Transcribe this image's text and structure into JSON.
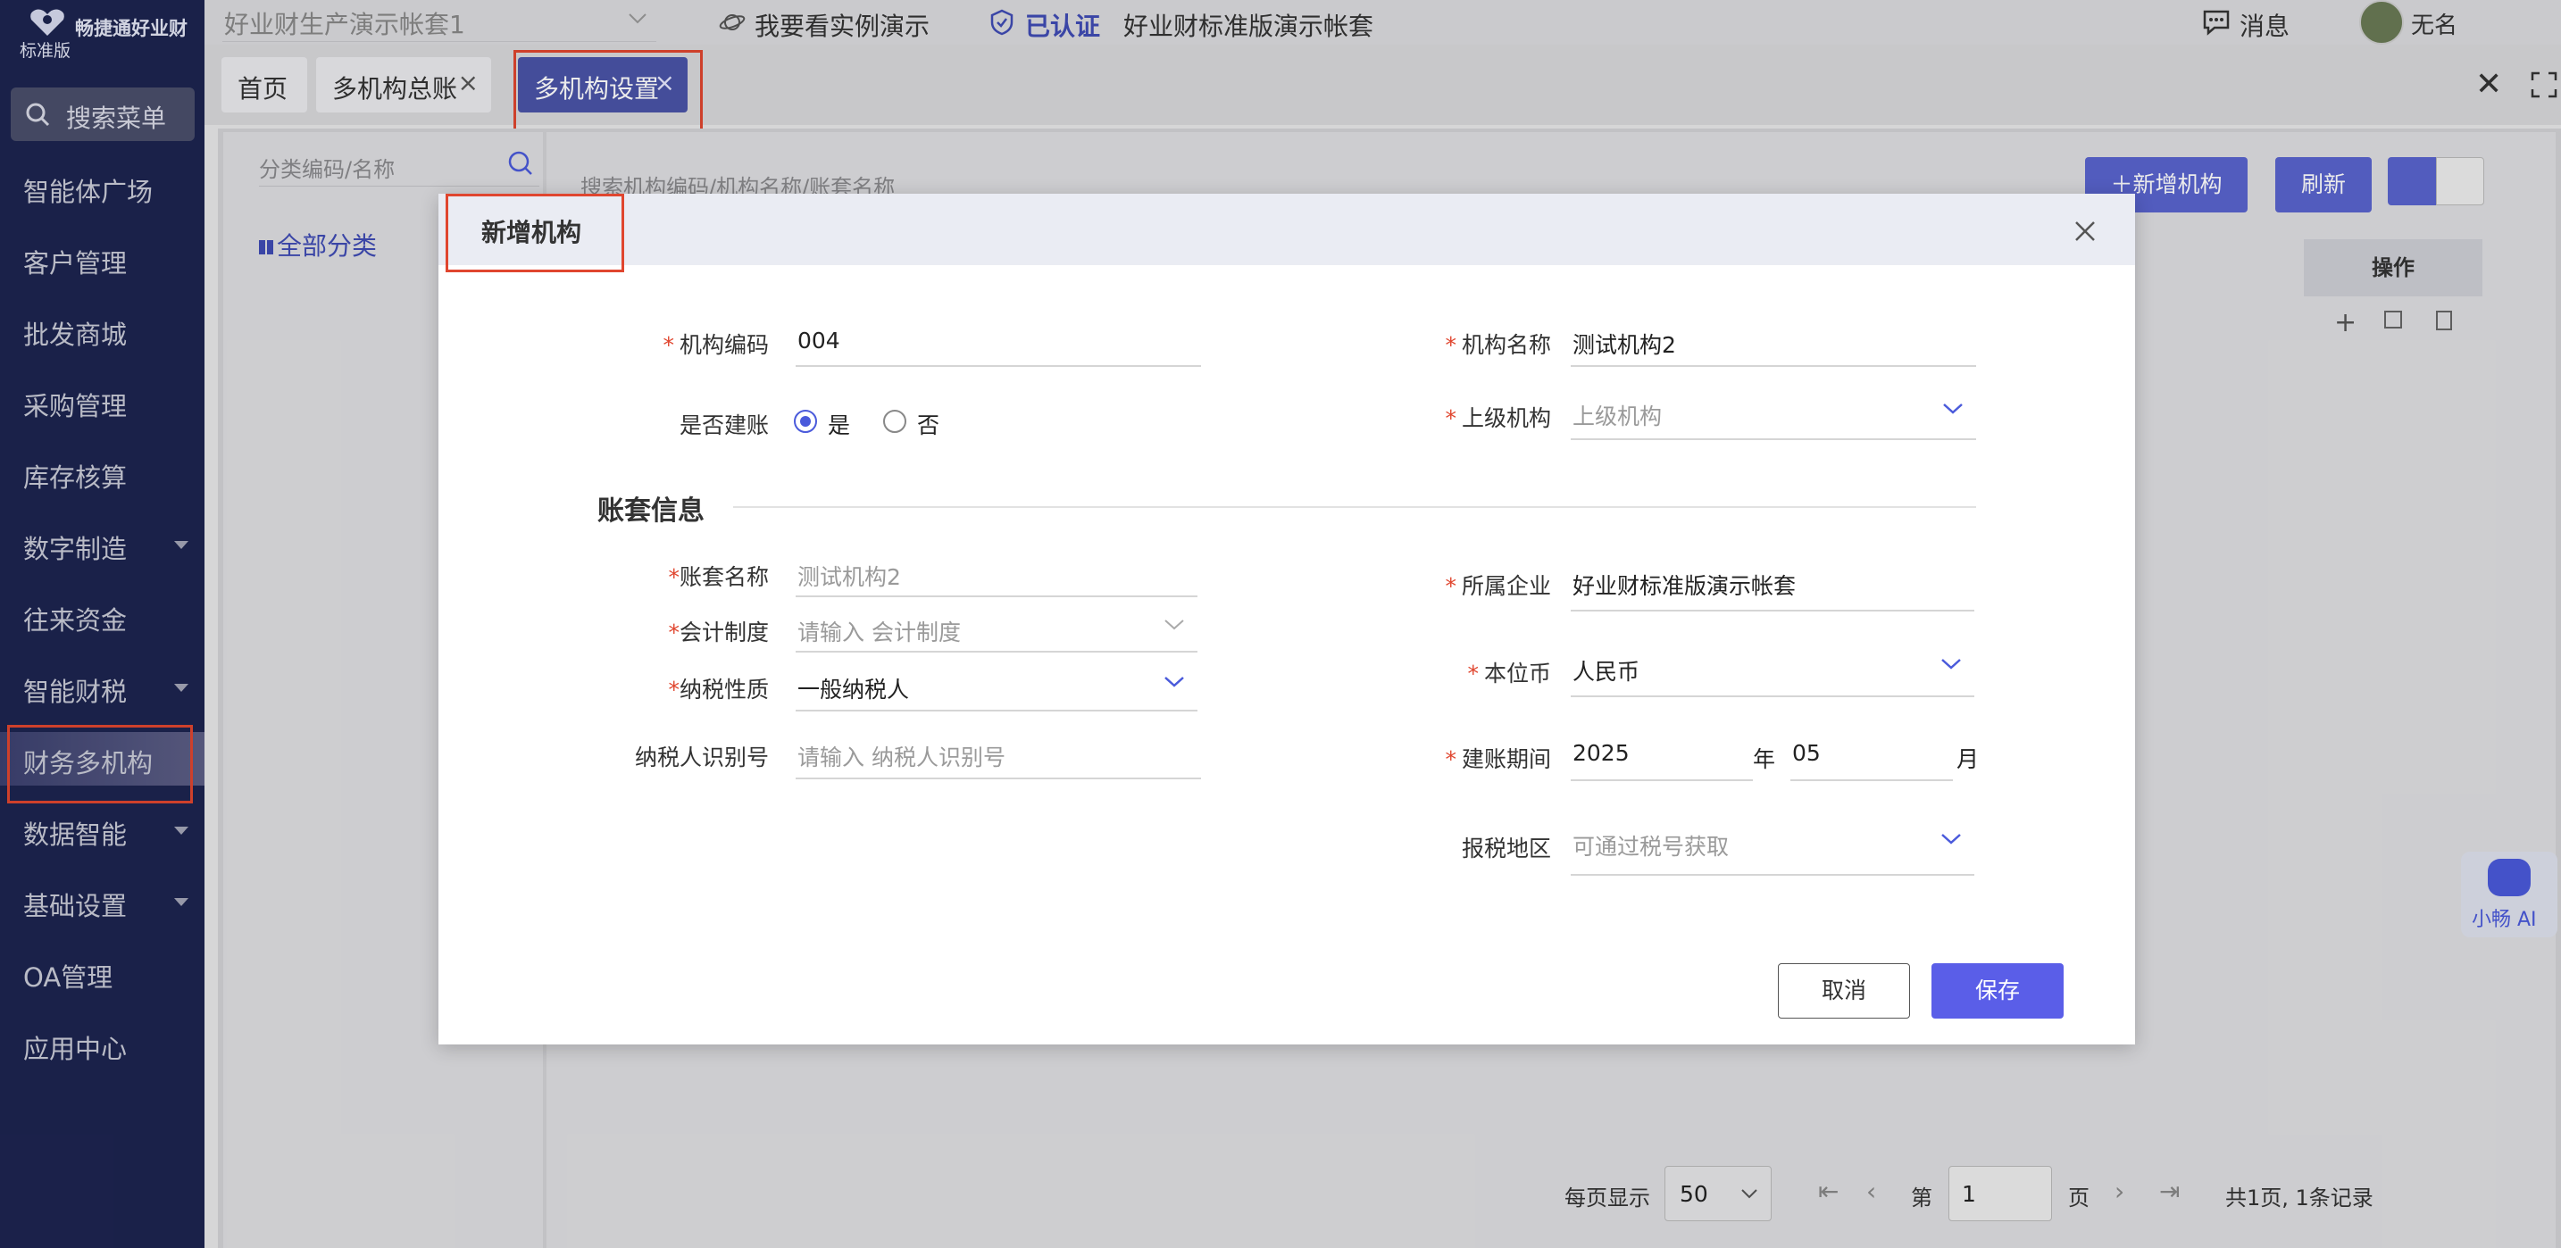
{
  "app": {
    "logo_name": "畅捷通好业财",
    "logo_version": "标准版",
    "account_select": "好业财生产演示帐套1",
    "demo_link": "我要看实例演示",
    "verified": "已认证",
    "account_name": "好业财标准版演示帐套",
    "messages": "消息",
    "user": "无名"
  },
  "sidebar": {
    "search": "搜索菜单",
    "items": [
      {
        "label": "智能体广场",
        "caret": false
      },
      {
        "label": "客户管理",
        "caret": false
      },
      {
        "label": "批发商城",
        "caret": false
      },
      {
        "label": "采购管理",
        "caret": false
      },
      {
        "label": "库存核算",
        "caret": false
      },
      {
        "label": "数字制造",
        "caret": true
      },
      {
        "label": "往来资金",
        "caret": false
      },
      {
        "label": "智能财税",
        "caret": true
      },
      {
        "label": "财务多机构",
        "caret": false,
        "active": true
      },
      {
        "label": "数据智能",
        "caret": true
      },
      {
        "label": "基础设置",
        "caret": true
      },
      {
        "label": "OA管理",
        "caret": false
      },
      {
        "label": "应用中心",
        "caret": false
      }
    ]
  },
  "tabs": [
    {
      "label": "首页",
      "closable": false
    },
    {
      "label": "多机构总账",
      "closable": true
    },
    {
      "label": "多机构设置",
      "closable": true,
      "active": true
    }
  ],
  "left_panel": {
    "search_placeholder": "分类编码/名称",
    "all_category": "全部分类"
  },
  "main_panel": {
    "search_placeholder": "搜索机构编码/机构名称/账套名称",
    "add_button": "＋新增机构",
    "refresh_button": "刷新",
    "col_action": "操作"
  },
  "pagination": {
    "per_page_label": "每页显示",
    "per_page": "50",
    "page_prefix": "第",
    "page": "1",
    "page_suffix": "页",
    "summary": "共1页, 1条记录"
  },
  "assistant": {
    "label": "小畅 AI"
  },
  "modal": {
    "title": "新增机构",
    "org_code_label": "机构编码",
    "org_code": "004",
    "org_name_label": "机构名称",
    "org_name": "测试机构2",
    "build_account_label": "是否建账",
    "yes": "是",
    "no": "否",
    "parent_org_label": "上级机构",
    "parent_org_placeholder": "上级机构",
    "section_title": "账套信息",
    "account_name_label": "账套名称",
    "account_name": "测试机构2",
    "company_label": "所属企业",
    "company": "好业财标准版演示帐套",
    "accounting_label": "会计制度",
    "accounting_placeholder": "请输入 会计制度",
    "tax_type_label": "纳税性质",
    "tax_type": "一般纳税人",
    "currency_label": "本位币",
    "currency": "人民币",
    "taxpayer_id_label": "纳税人识别号",
    "taxpayer_id_placeholder": "请输入 纳税人识别号",
    "period_label": "建账期间",
    "period_year": "2025",
    "year_unit": "年",
    "period_month": "05",
    "month_unit": "月",
    "region_label": "报税地区",
    "region_placeholder": "可通过税号获取",
    "cancel": "取消",
    "save": "保存"
  },
  "colors": {
    "accent": "#4a5adb",
    "sidebar": "#1d2450",
    "highlight": "#e0462f"
  }
}
